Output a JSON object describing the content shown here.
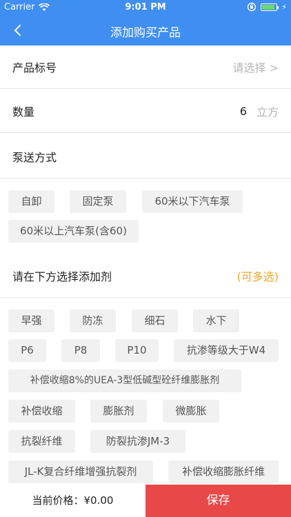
{
  "status_bar": {
    "carrier": "Carrier",
    "time": "9:01 PM"
  },
  "nav": {
    "title": "添加购买产品"
  },
  "product_code": {
    "label": "产品标号",
    "placeholder": "请选择 >"
  },
  "quantity": {
    "label": "数量",
    "value": "6",
    "unit": "立方"
  },
  "pump": {
    "label": "泵送方式",
    "options": [
      "自卸",
      "固定泵",
      "60米以下汽车泵",
      "60米以上汽车泵(含60)"
    ]
  },
  "additives": {
    "label": "请在下方选择添加剂",
    "hint": "(可多选)",
    "options": [
      "早强",
      "防冻",
      "细石",
      "水下",
      "P6",
      "P8",
      "P10",
      "抗渗等级大于W4",
      "补偿收缩8%的UEA-3型低碱型砼纤维膨胀剂",
      "补偿收缩",
      "膨胀剂",
      "微膨胀",
      "抗裂纤维",
      "防裂抗渗JM-3",
      "JL-K复合纤维增强抗裂剂",
      "补偿收缩膨胀纤维"
    ]
  },
  "footer": {
    "price_label": "当前价格：¥0.00",
    "save_label": "保存"
  },
  "colors": {
    "header": "#3f8ef1",
    "save": "#e84848",
    "hint": "#f5a623",
    "tag_bg": "#f1f1f1"
  }
}
